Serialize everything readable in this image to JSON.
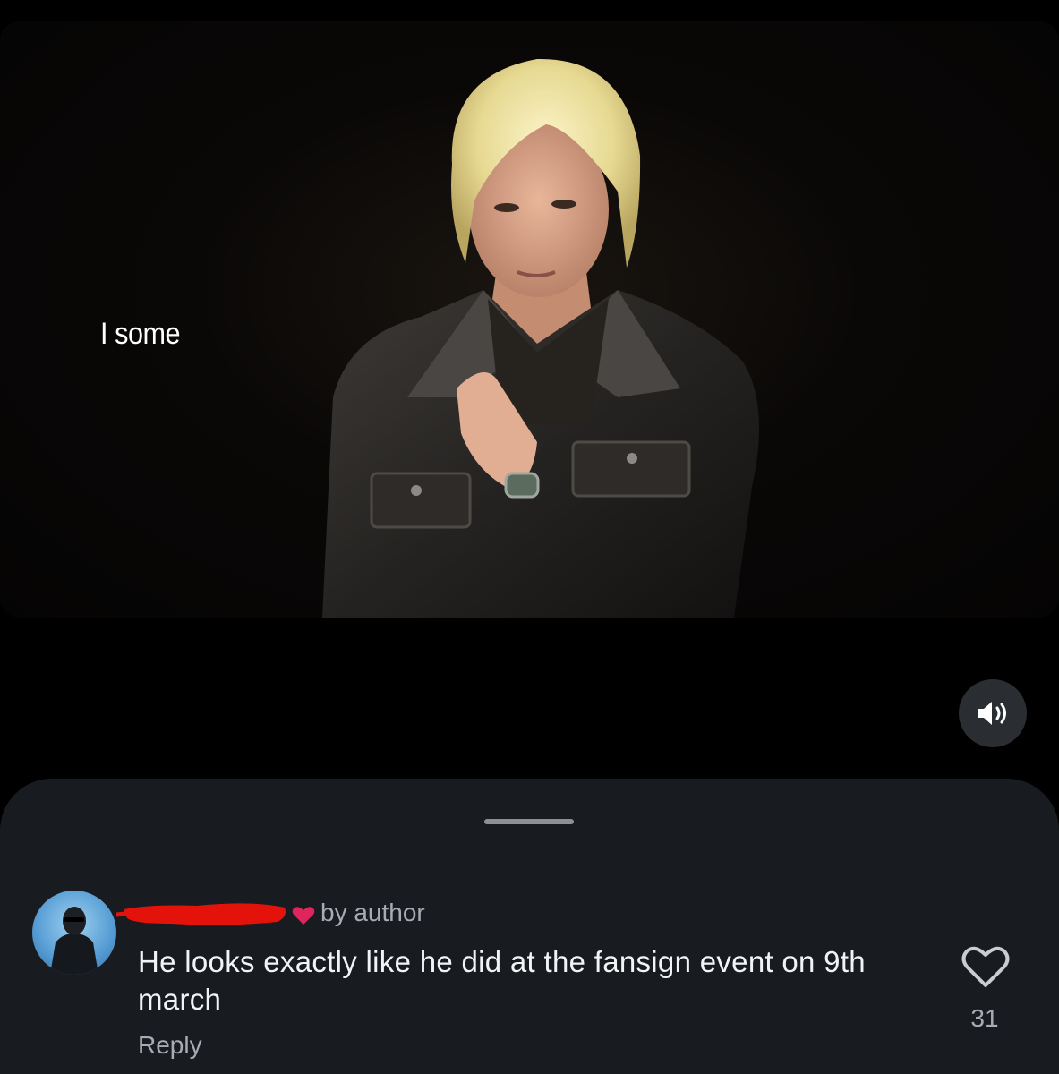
{
  "video": {
    "caption": "I some",
    "sound_icon": "speaker-sound-on-icon"
  },
  "comment": {
    "author_badge_icon": "heart-icon",
    "author_badge": "by author",
    "text": "He looks exactly like he did at the fansign event on 9th march",
    "reply_label": "Reply",
    "like_icon": "heart-outline-icon",
    "like_count": "31"
  },
  "colors": {
    "sheet_background": "#181b1f",
    "badge_heart": "#e0245e",
    "redaction": "#e3120b",
    "muted_text": "#a8acb2"
  }
}
